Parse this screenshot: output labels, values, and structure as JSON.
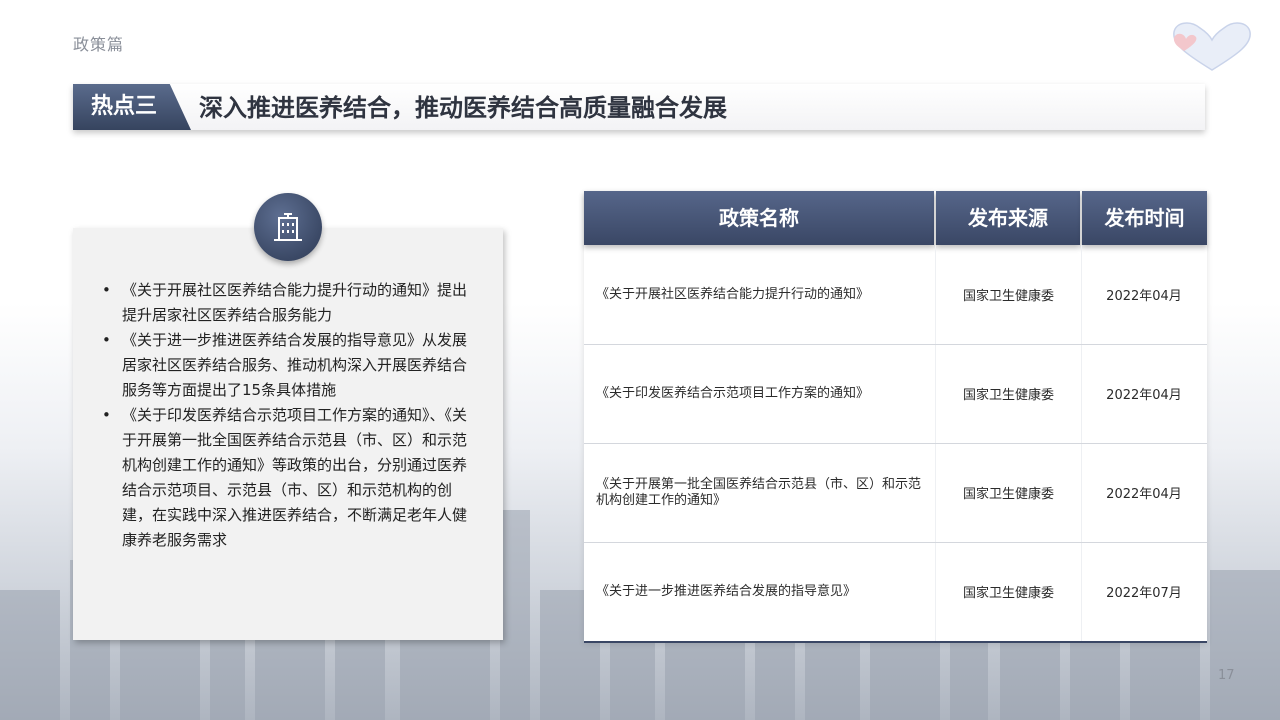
{
  "header": {
    "section": "政策篇",
    "tag": "热点三",
    "title": "深入推进医养结合，推动医养结合高质量融合发展"
  },
  "left_panel": {
    "icon": "building-icon",
    "bullets": [
      "《关于开展社区医养结合能力提升行动的通知》提出提升居家社区医养结合服务能力",
      "《关于进一步推进医养结合发展的指导意见》从发展居家社区医养结合服务、推动机构深入开展医养结合服务等方面提出了15条具体措施",
      "《关于印发医养结合示范项目工作方案的通知》、《关于开展第一批全国医养结合示范县（市、区）和示范机构创建工作的通知》等政策的出台，分别通过医养结合示范项目、示范县（市、区）和示范机构的创建，在实践中深入推进医养结合，不断满足老年人健康养老服务需求"
    ]
  },
  "table": {
    "headers": [
      "政策名称",
      "发布来源",
      "发布时间"
    ],
    "rows": [
      {
        "name": "《关于开展社区医养结合能力提升行动的通知》",
        "source": "国家卫生健康委",
        "date": "2022年04月"
      },
      {
        "name": "《关于印发医养结合示范项目工作方案的通知》",
        "source": "国家卫生健康委",
        "date": "2022年04月"
      },
      {
        "name": "《关于开展第一批全国医养结合示范县（市、区）和示范机构创建工作的通知》",
        "source": "国家卫生健康委",
        "date": "2022年04月"
      },
      {
        "name": "《关于进一步推进医养结合发展的指导意见》",
        "source": "国家卫生健康委",
        "date": "2022年07月"
      }
    ]
  },
  "footer": {
    "page_number": "17"
  },
  "colors": {
    "accent": "#3a4765",
    "accent_light": "#56668a",
    "text": "#2f3440"
  }
}
